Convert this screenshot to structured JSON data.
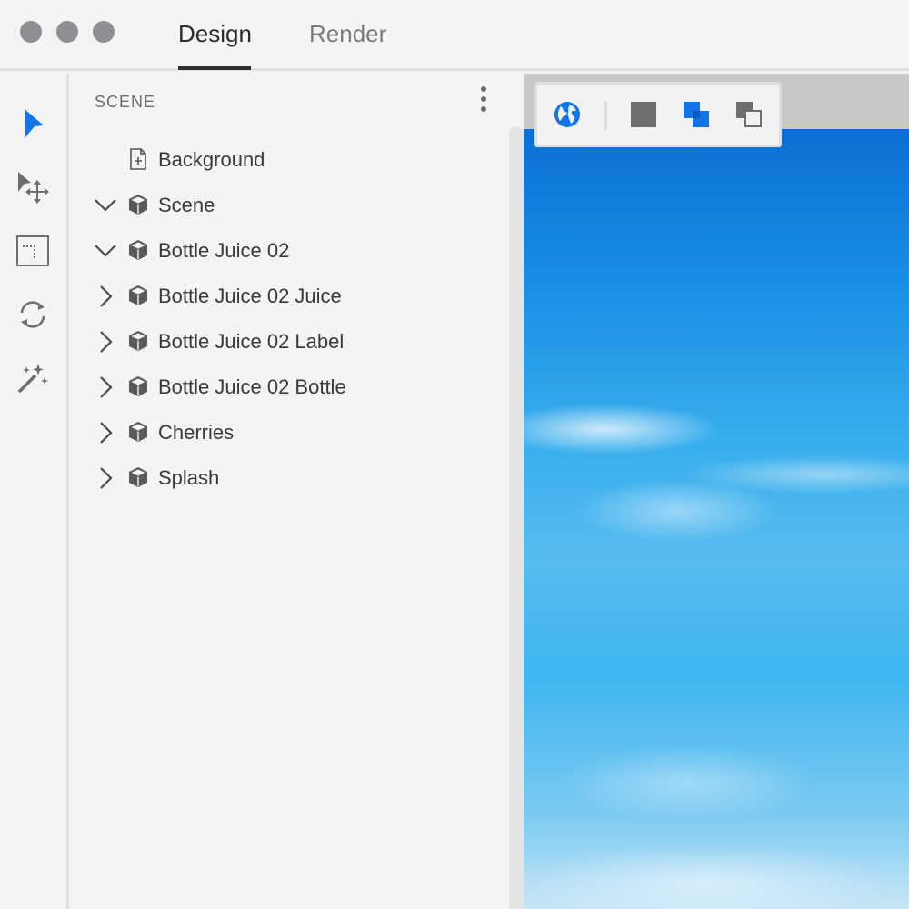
{
  "window": {
    "controls": [
      "close",
      "minimize",
      "maximize"
    ]
  },
  "tabs": [
    {
      "label": "Design",
      "active": true
    },
    {
      "label": "Render",
      "active": false
    }
  ],
  "tools": [
    {
      "icon": "select-arrow-icon",
      "active": true
    },
    {
      "icon": "move-transform-icon",
      "active": false
    },
    {
      "icon": "crop-frame-icon",
      "active": false
    },
    {
      "icon": "rotate-icon",
      "active": false
    },
    {
      "icon": "magic-wand-icon",
      "active": false
    }
  ],
  "scene_panel": {
    "title": "SCENE",
    "items": [
      {
        "label": "Background",
        "icon": "document-add-icon",
        "chevron": "none"
      },
      {
        "label": "Scene",
        "icon": "cube-icon",
        "chevron": "down"
      },
      {
        "label": "Bottle Juice 02",
        "icon": "cube-icon",
        "chevron": "down"
      },
      {
        "label": "Bottle Juice 02 Juice",
        "icon": "cube-icon",
        "chevron": "right"
      },
      {
        "label": "Bottle Juice 02 Label",
        "icon": "cube-icon",
        "chevron": "right"
      },
      {
        "label": "Bottle Juice 02 Bottle",
        "icon": "cube-icon",
        "chevron": "right"
      },
      {
        "label": "Cherries",
        "icon": "cube-icon",
        "chevron": "right"
      },
      {
        "label": "Splash",
        "icon": "cube-icon",
        "chevron": "right"
      }
    ]
  },
  "viewport_toolbar": {
    "buttons": [
      "globe-icon",
      "square-icon",
      "overlap-squares-icon",
      "layered-squares-icon"
    ],
    "active": "overlap-squares-icon"
  },
  "colors": {
    "accent": "#1473e6",
    "icon": "#6e6e6e",
    "text": "#3a3a3a"
  }
}
